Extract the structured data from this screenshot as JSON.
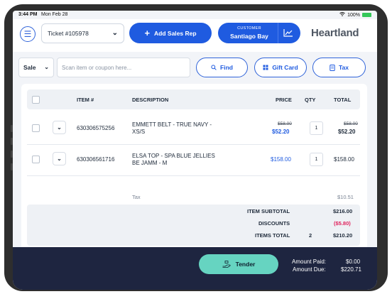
{
  "status_bar": {
    "time": "3:44 PM",
    "date": "Mon Feb 28",
    "battery": "100%"
  },
  "header": {
    "ticket_label": "Ticket #105978",
    "add_sales_rep_label": "Add Sales Rep",
    "customer_caption": "CUSTOMER",
    "customer_name": "Santiago Bay",
    "logo_text": "Heartland"
  },
  "search": {
    "mode": "Sale",
    "placeholder": "Scan item or coupon here...",
    "find_label": "Find",
    "gift_card_label": "Gift Card",
    "tax_label": "Tax"
  },
  "table": {
    "columns": {
      "item": "ITEM #",
      "description": "DESCRIPTION",
      "price": "PRICE",
      "qty": "QTY",
      "total": "TOTAL"
    },
    "rows": [
      {
        "item": "630306575256",
        "description_line1": "EMMETT BELT - TRUE NAVY -",
        "description_line2": "XS/S",
        "orig_price": "$58.00",
        "price": "$52.20",
        "qty": "1",
        "orig_total": "$58.00",
        "total": "$52.20"
      },
      {
        "item": "630306561716",
        "description_line1": "ELSA TOP - SPA BLUE JELLIES",
        "description_line2": "BE JAMM - M",
        "price": "$158.00",
        "qty": "1",
        "total": "$158.00"
      }
    ],
    "tax_label": "Tax",
    "tax_value": "$10.51"
  },
  "totals": {
    "item_subtotal_label": "ITEM SUBTOTAL",
    "item_subtotal_value": "$216.00",
    "discounts_label": "DISCOUNTS",
    "discounts_value": "($5.80)",
    "items_total_label": "ITEMS TOTAL",
    "items_total_count": "2",
    "items_total_value": "$210.20"
  },
  "footer": {
    "tender_label": "Tender",
    "amount_paid_label": "Amount Paid:",
    "amount_paid_value": "$0.00",
    "amount_due_label": "Amount Due:",
    "amount_due_value": "$220.71"
  },
  "colors": {
    "primary": "#1f5be0",
    "tender": "#66d4c1",
    "discount": "#e0245e",
    "footer_bg": "#1e2540"
  }
}
